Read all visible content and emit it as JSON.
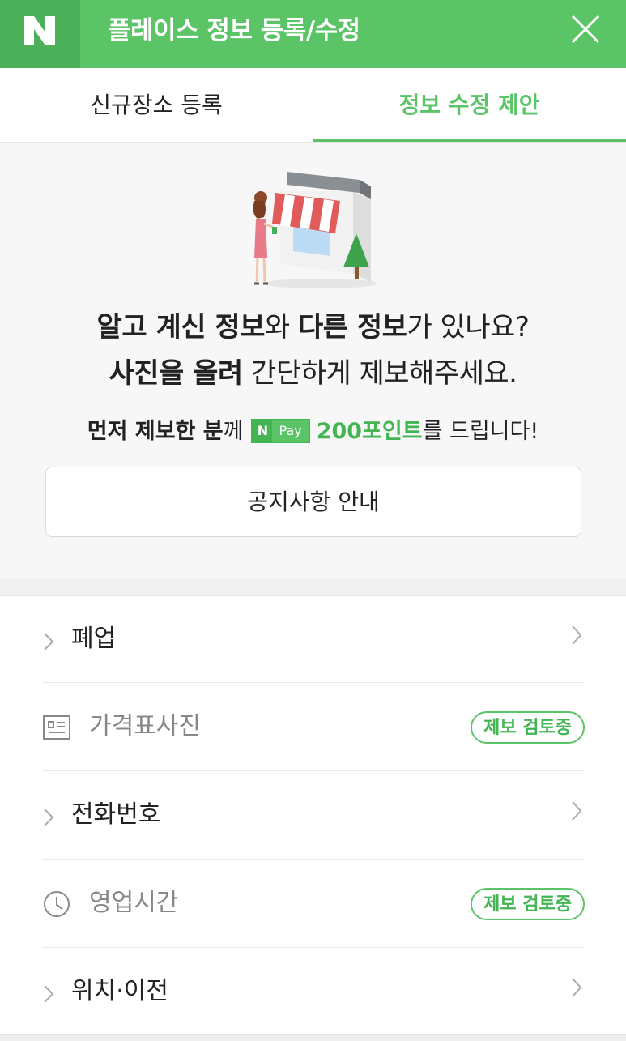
{
  "header": {
    "logo": "N",
    "title": "플레이스 정보 등록/수정",
    "close_icon": "close-icon",
    "bg_color": "#5ac466"
  },
  "tabs": [
    {
      "label": "신규장소 등록",
      "active": false
    },
    {
      "label": "정보 수정 제안",
      "active": true
    }
  ],
  "intro": {
    "line1_bold1": "알고 계신 정보",
    "line1_text1": "와 ",
    "line1_bold2": "다른 정보",
    "line1_text2": "가 있나요?",
    "line2_bold": "사진을 올려",
    "line2_text": " 간단하게 제보해주세요.",
    "reward_bold": "먼저 제보한 분",
    "reward_text1": "께",
    "npay_n": "N",
    "npay_label": "Pay",
    "reward_points": "200포인트",
    "reward_text2": "를 드립니다!",
    "notice_button": "공지사항 안내"
  },
  "list": [
    {
      "label": "폐업",
      "type": "link"
    },
    {
      "label": "가격표사진",
      "type": "reviewing",
      "badge": "제보 검토중",
      "icon": "menu-board-icon"
    },
    {
      "label": "전화번호",
      "type": "link"
    },
    {
      "label": "영업시간",
      "type": "reviewing",
      "badge": "제보 검토중",
      "icon": "clock-icon"
    },
    {
      "label": "위치·이전",
      "type": "link"
    }
  ],
  "colors": {
    "accent": "#5ac466",
    "accent_dark": "#43b553",
    "text": "#222222",
    "muted": "#888888"
  }
}
